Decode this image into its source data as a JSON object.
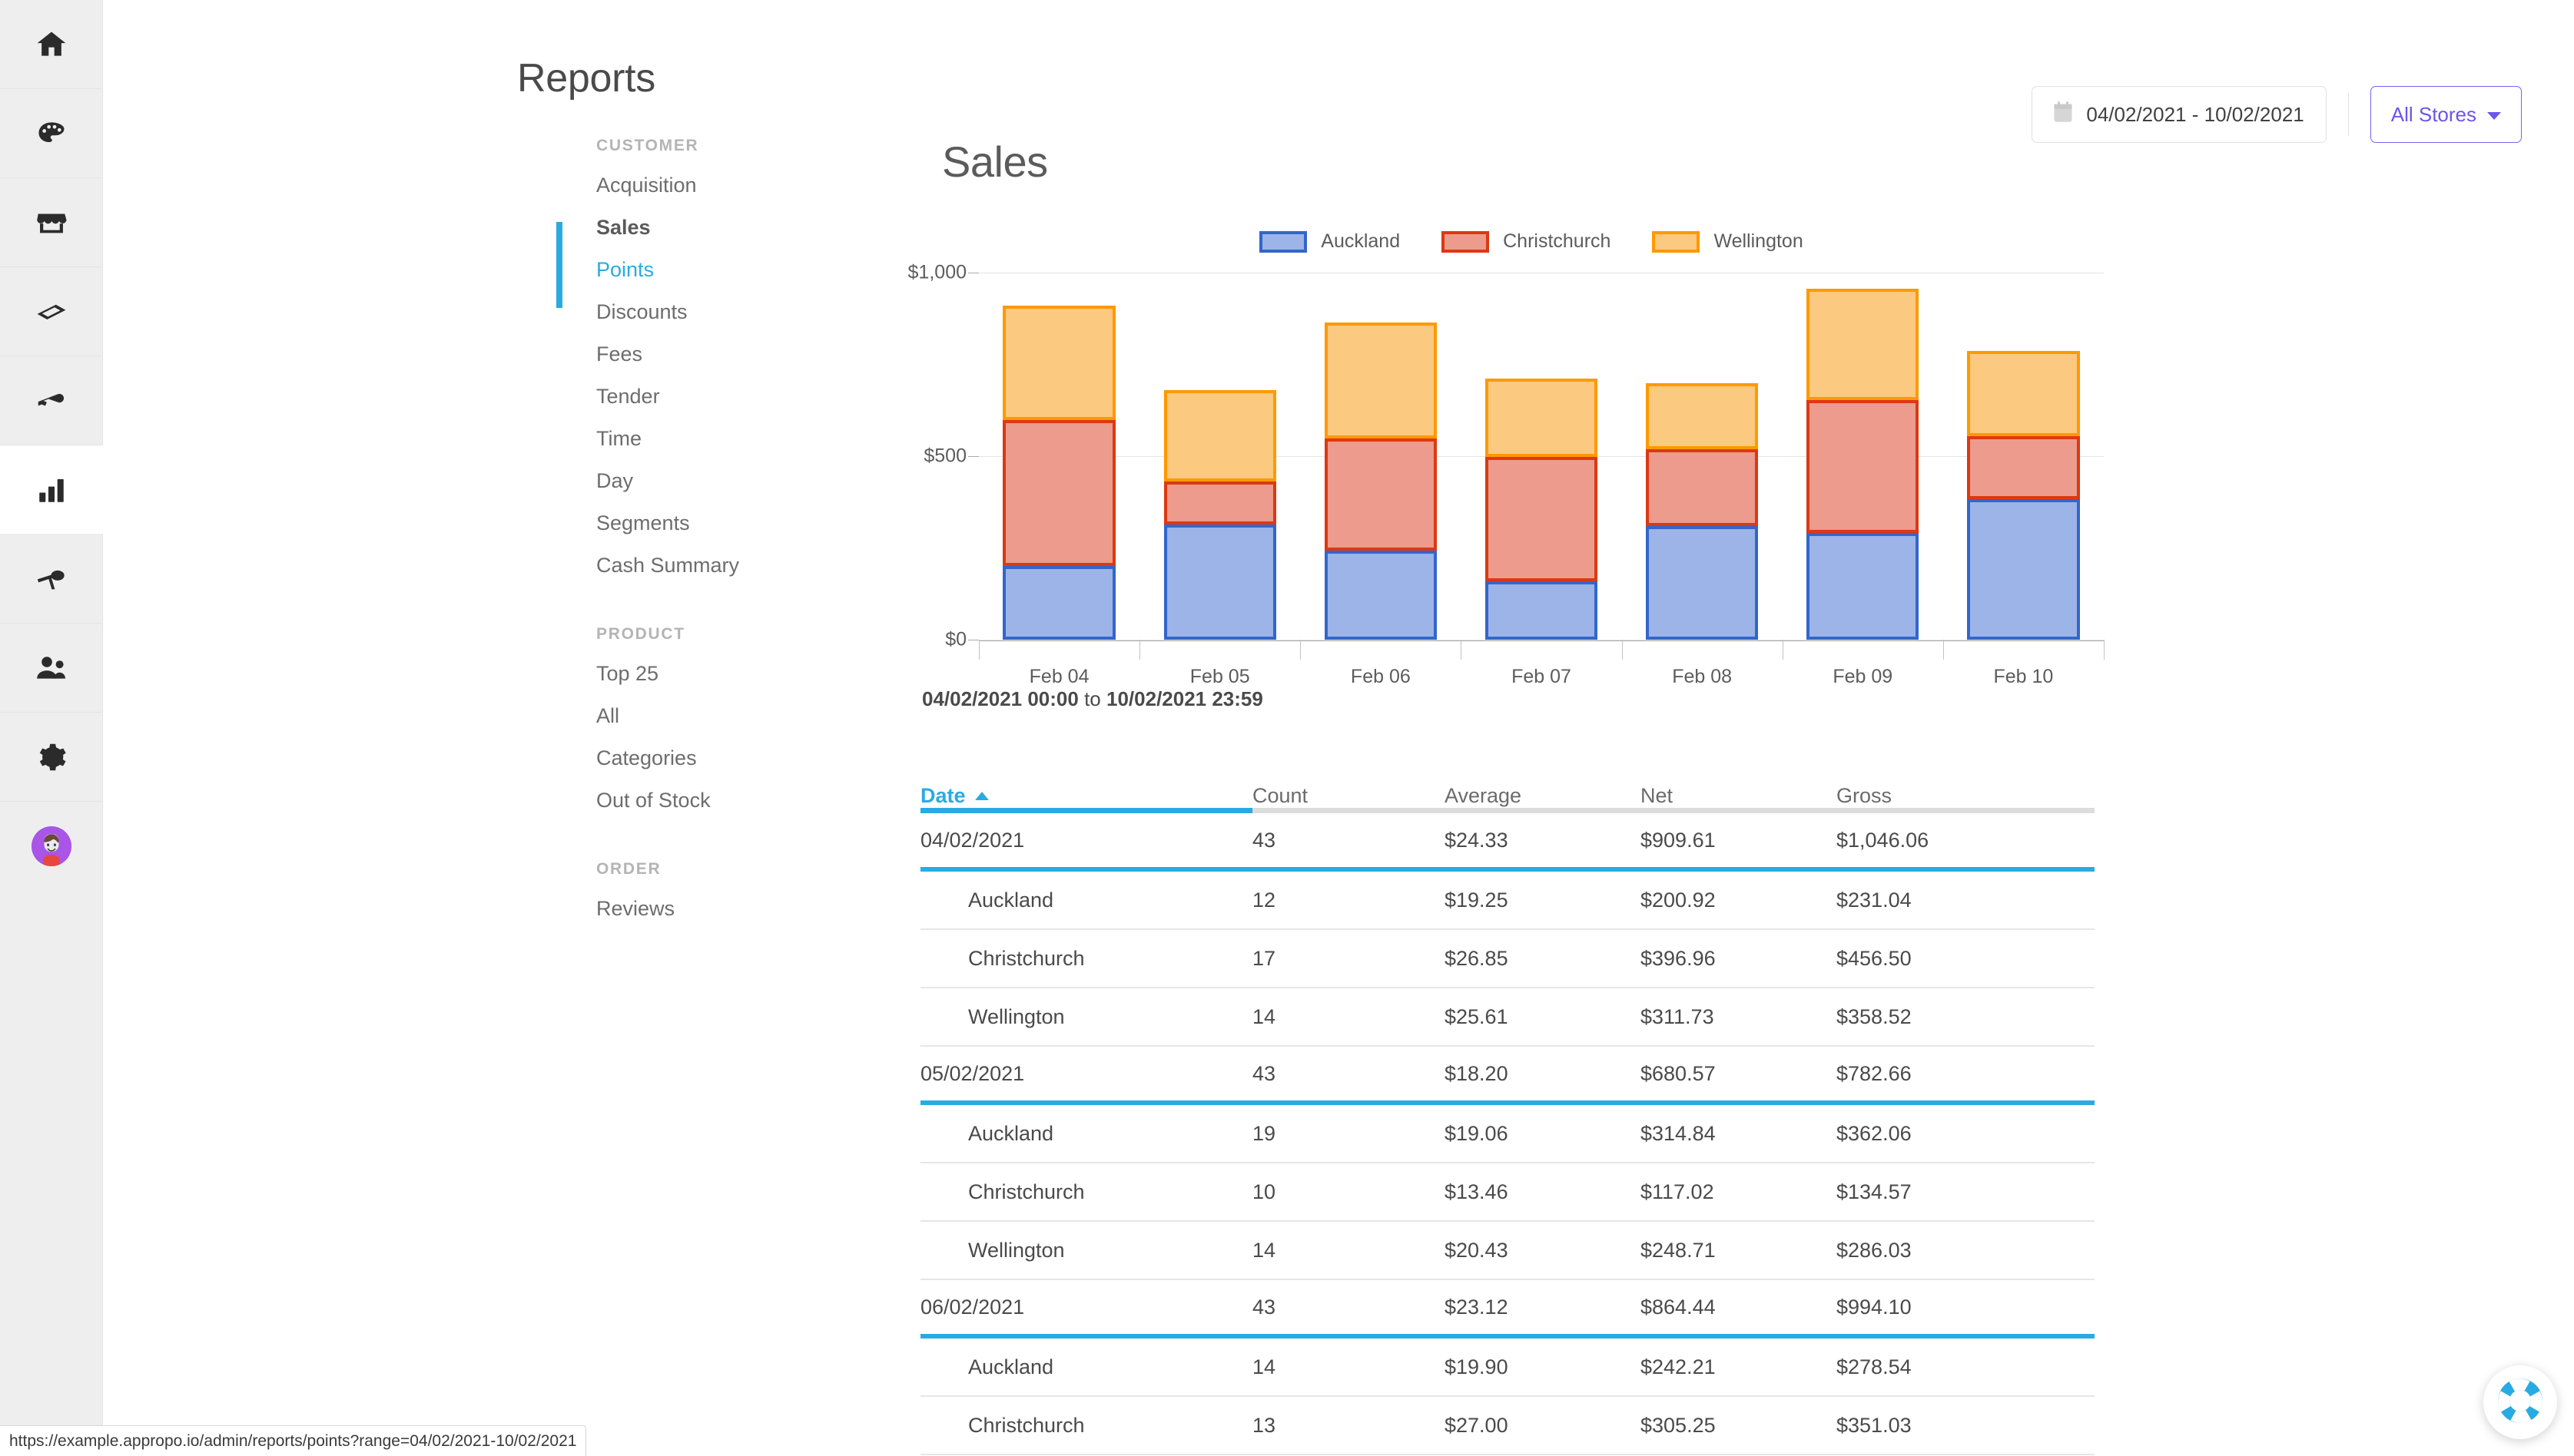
{
  "icon_rail": {
    "items": [
      {
        "name": "home-icon",
        "label": "Home",
        "active": false
      },
      {
        "name": "palette-icon",
        "label": "Design",
        "active": false
      },
      {
        "name": "storefront-icon",
        "label": "Store",
        "active": false
      },
      {
        "name": "ticket-icon",
        "label": "Tickets",
        "active": false
      },
      {
        "name": "megaphone-icon",
        "label": "Marketing",
        "active": false
      },
      {
        "name": "bar-chart-icon",
        "label": "Reports",
        "active": true
      },
      {
        "name": "signpost-icon",
        "label": "Navigation",
        "active": false
      },
      {
        "name": "people-icon",
        "label": "Customers",
        "active": false
      },
      {
        "name": "gear-icon",
        "label": "Settings",
        "active": false
      }
    ],
    "avatar_label": "User avatar"
  },
  "reports_nav": {
    "title": "Reports",
    "groups": [
      {
        "label": "CUSTOMER",
        "items": [
          {
            "label": "Acquisition",
            "state": "normal"
          },
          {
            "label": "Sales",
            "state": "bold"
          },
          {
            "label": "Points",
            "state": "current"
          },
          {
            "label": "Discounts",
            "state": "normal"
          },
          {
            "label": "Fees",
            "state": "normal"
          },
          {
            "label": "Tender",
            "state": "normal"
          },
          {
            "label": "Time",
            "state": "normal"
          },
          {
            "label": "Day",
            "state": "normal"
          },
          {
            "label": "Segments",
            "state": "normal"
          },
          {
            "label": "Cash Summary",
            "state": "normal"
          }
        ]
      },
      {
        "label": "PRODUCT",
        "items": [
          {
            "label": "Top 25",
            "state": "normal"
          },
          {
            "label": "All",
            "state": "normal"
          },
          {
            "label": "Categories",
            "state": "normal"
          },
          {
            "label": "Out of Stock",
            "state": "normal"
          }
        ]
      },
      {
        "label": "ORDER",
        "items": [
          {
            "label": "Reviews",
            "state": "normal"
          }
        ]
      }
    ]
  },
  "header": {
    "date_range": "04/02/2021 - 10/02/2021",
    "calendar_icon": "calendar-icon",
    "store_filter": "All Stores"
  },
  "section": {
    "title": "Sales",
    "range_caption_start": "04/02/2021 00:00",
    "range_caption_mid": " to ",
    "range_caption_end": "10/02/2021 23:59"
  },
  "colors": {
    "accent_blue": "#29abe2",
    "purple": "#6c55e8",
    "auckland_fill": "#9cb4e8",
    "auckland_stroke": "#3366cc",
    "christchurch_fill": "#ec9b8d",
    "christchurch_stroke": "#dc3912",
    "wellington_fill": "#fbc97f",
    "wellington_stroke": "#ff9900"
  },
  "chart_data": {
    "type": "bar",
    "stacked": true,
    "title": "",
    "xlabel": "",
    "ylabel": "",
    "ylim": [
      0,
      1000
    ],
    "yticks": [
      0,
      500,
      1000
    ],
    "ytick_labels": [
      "$0",
      "$500",
      "$1,000"
    ],
    "grid": true,
    "legend_position": "top-center",
    "categories": [
      "Feb 04",
      "Feb 05",
      "Feb 06",
      "Feb 07",
      "Feb 08",
      "Feb 09",
      "Feb 10"
    ],
    "series": [
      {
        "name": "Auckland",
        "fill": "#9cb4e8",
        "stroke": "#3366cc",
        "values": [
          200.92,
          314.84,
          242.21,
          160.0,
          310.0,
          290.0,
          382.0
        ]
      },
      {
        "name": "Christchurch",
        "fill": "#ec9b8d",
        "stroke": "#dc3912",
        "values": [
          396.96,
          117.02,
          305.25,
          339.0,
          209.0,
          362.0,
          172.0
        ]
      },
      {
        "name": "Wellington",
        "fill": "#fbc97f",
        "stroke": "#ff9900",
        "values": [
          311.73,
          248.71,
          316.98,
          213.0,
          180.0,
          304.0,
          232.0
        ]
      }
    ],
    "totals": [
      909.61,
      680.57,
      864.44,
      712.0,
      699.0,
      956.0,
      786.0
    ]
  },
  "table": {
    "columns": [
      "Date",
      "Count",
      "Average",
      "Net",
      "Gross"
    ],
    "sort_column": "Date",
    "sort_direction": "asc",
    "rows": [
      {
        "type": "group",
        "date": "04/02/2021",
        "count": "43",
        "average": "$24.33",
        "net": "$909.61",
        "gross": "$1,046.06"
      },
      {
        "type": "child",
        "date": "Auckland",
        "count": "12",
        "average": "$19.25",
        "net": "$200.92",
        "gross": "$231.04"
      },
      {
        "type": "child",
        "date": "Christchurch",
        "count": "17",
        "average": "$26.85",
        "net": "$396.96",
        "gross": "$456.50"
      },
      {
        "type": "child",
        "date": "Wellington",
        "count": "14",
        "average": "$25.61",
        "net": "$311.73",
        "gross": "$358.52"
      },
      {
        "type": "group",
        "date": "05/02/2021",
        "count": "43",
        "average": "$18.20",
        "net": "$680.57",
        "gross": "$782.66"
      },
      {
        "type": "child",
        "date": "Auckland",
        "count": "19",
        "average": "$19.06",
        "net": "$314.84",
        "gross": "$362.06"
      },
      {
        "type": "child",
        "date": "Christchurch",
        "count": "10",
        "average": "$13.46",
        "net": "$117.02",
        "gross": "$134.57"
      },
      {
        "type": "child",
        "date": "Wellington",
        "count": "14",
        "average": "$20.43",
        "net": "$248.71",
        "gross": "$286.03"
      },
      {
        "type": "group",
        "date": "06/02/2021",
        "count": "43",
        "average": "$23.12",
        "net": "$864.44",
        "gross": "$994.10"
      },
      {
        "type": "child",
        "date": "Auckland",
        "count": "14",
        "average": "$19.90",
        "net": "$242.21",
        "gross": "$278.54"
      },
      {
        "type": "child",
        "date": "Christchurch",
        "count": "13",
        "average": "$27.00",
        "net": "$305.25",
        "gross": "$351.03"
      }
    ]
  },
  "status_bar": {
    "url": "https://example.appropo.io/admin/reports/points?range=04/02/2021-10/02/2021"
  },
  "help": {
    "icon": "lifebuoy-icon",
    "label": "Help"
  }
}
